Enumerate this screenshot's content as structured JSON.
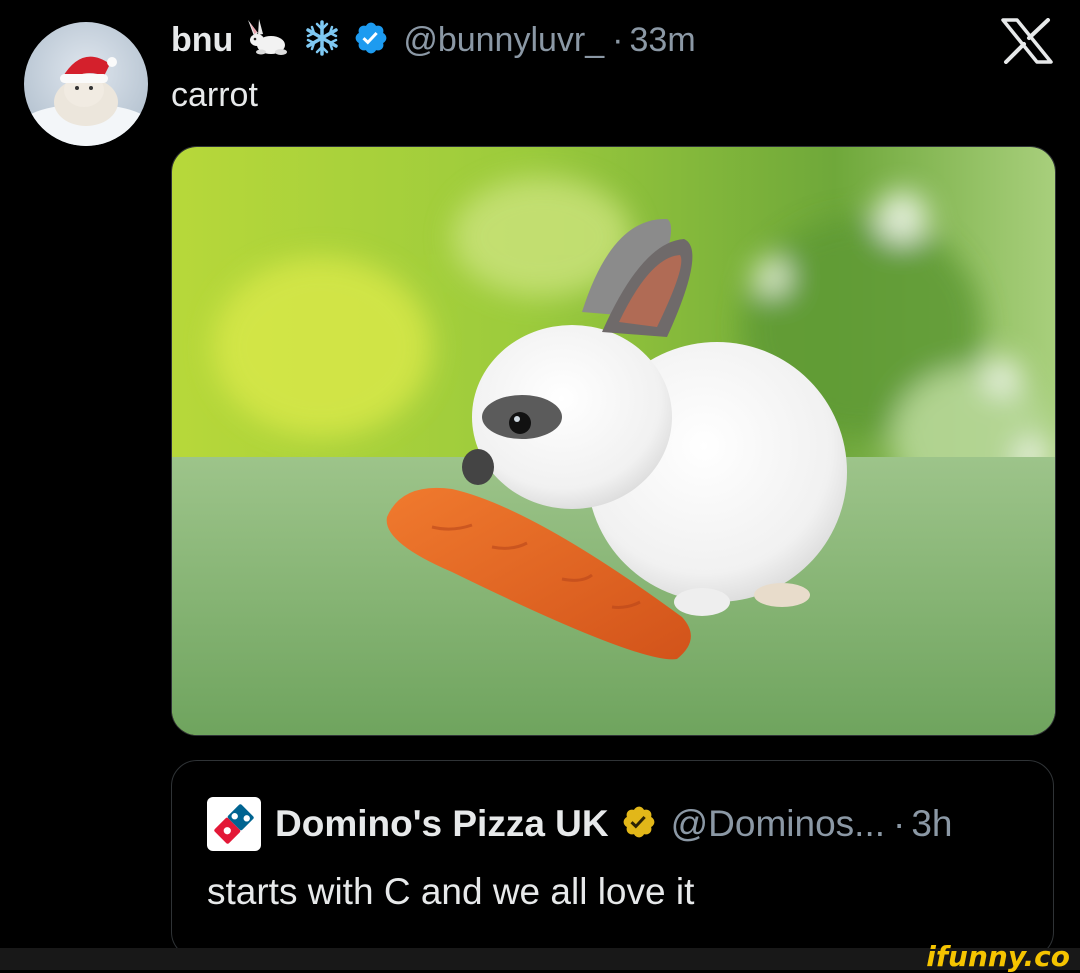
{
  "tweet": {
    "display_name": "bnu",
    "handle": "@bunnyluvr_",
    "separator": "·",
    "time": "33m",
    "text": "carrot",
    "name_emojis": [
      "rabbit-emoji",
      "snowflake-emoji"
    ],
    "verified": true
  },
  "quoted_tweet": {
    "display_name": "Domino's Pizza UK",
    "handle": "@Dominos...",
    "separator": "·",
    "time": "3h",
    "text": "starts with C and we all love it",
    "verified_badge": "gold-verified-badge"
  },
  "platform_logo": "x-logo",
  "watermark": "ifunny.co",
  "colors": {
    "background": "#000000",
    "text_primary": "#e7e9ea",
    "text_secondary": "#8b98a5",
    "verified_blue": "#1d9bf0",
    "verified_gold": "#e2b719",
    "watermark": "#f5c400"
  }
}
